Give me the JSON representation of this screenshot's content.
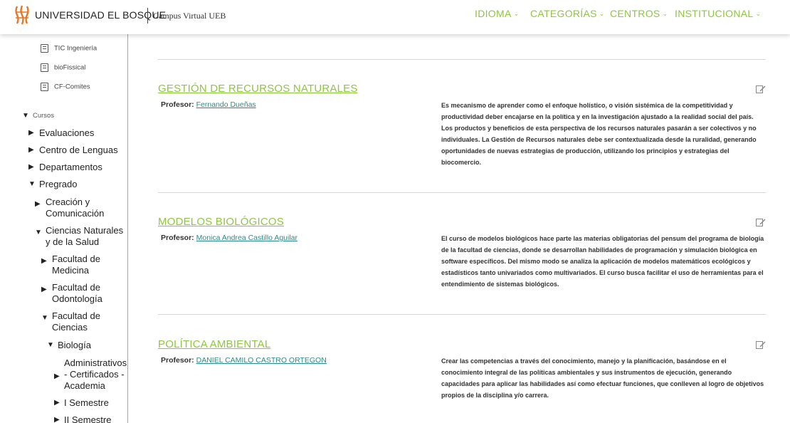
{
  "header": {
    "brand": "UNIVERSIDAD EL BOSQUE",
    "campus": "Campus Virtual UEB",
    "nav": [
      "IDIOMA",
      "CATEGORÍAS",
      "CENTROS",
      "INSTITUCIONAL"
    ],
    "accent_color": "#8dc63f",
    "logo_icon": "bosque-logo-icon"
  },
  "sidebar": {
    "links": [
      "TIC Ingeniería",
      "bioFissical",
      "CF-Comites"
    ],
    "cursos_label": "Cursos",
    "tree": {
      "evaluaciones": "Evaluaciones",
      "centro_lenguas": "Centro de Lenguas",
      "departamentos": "Departamentos",
      "pregrado": "Pregrado",
      "creacion": "Creación y Comunicación",
      "ciencias": "Ciencias Naturales y de la Salud",
      "medicina": "Facultad de Medicina",
      "odontologia": "Facultad de Odontología",
      "facultad_ciencias": "Facultad de Ciencias",
      "biologia": "Biología",
      "administrativos": "Administrativos - Certificados - Academia",
      "semestre1": "I Semestre",
      "semestre2": "II Semestre"
    }
  },
  "courses": [
    {
      "title": "GESTIÓN DE RECURSOS NATURALES",
      "prof_label": "Profesor:",
      "prof_name": "Fernando Dueñas",
      "summary": "Es mecanismo de aprender como el enfoque holístico, o visión sistémica de la competitividad y productividad deber encajarse en la política y en la investigación ajustado a la realidad social del país. Los productos y beneficios de esta perspectiva de los recursos naturales pasarán a ser colectivos y no individuales. La Gestión de Recursos naturales debe ser contextualizada desde la ruralidad, generando oportunidades de nuevas estrategias de producción, utilizando los principios y estrategias del biocomercio."
    },
    {
      "title": "MODELOS BIOLÓGICOS",
      "prof_label": "Profesor:",
      "prof_name": "Monica Andrea Castillo Aguilar",
      "summary": "El curso de modelos biológicos hace parte las materias obligatorias del pensum del programa de biología de la facultad de ciencias, donde se desarrollan habilidades de programación y simulación biológica en software específicos. Del mismo modo se analiza la aplicación de modelos matemáticos ecológicos y estadísticos tanto univariados como multivariados. El curso busca facilitar el uso de herramientas para el entendimiento de sistemas biológicos."
    },
    {
      "title": "POLÍTICA AMBIENTAL",
      "prof_label": "Profesor:",
      "prof_name": "DANIEL CAMILO CASTRO ORTEGON",
      "summary": "Crear las competencias a través del conocimiento, manejo y la planificación, basándose en el conocimiento integral de las políticas ambientales y sus instrumentos de ejecución, generando capacidades para aplicar las habilidades así como efectuar funciones, que conlleven al logro de objetivos propios de la disciplina y/o carrera."
    }
  ]
}
